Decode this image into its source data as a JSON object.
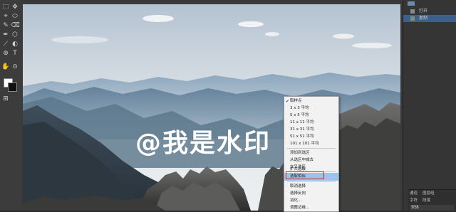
{
  "tools": [
    "⬚",
    "✥",
    "⌖",
    "⬭",
    "✎",
    "⌫",
    "✒",
    "⬡",
    "⟋",
    "◐",
    "⊕",
    "T",
    "✋",
    "⊙",
    "⊞"
  ],
  "history_panel": {
    "file_label": "",
    "items": [
      {
        "label": "打开"
      },
      {
        "label": "复制"
      }
    ]
  },
  "watermark_text": "@我是水印",
  "context_menu": {
    "items": [
      {
        "label": "取样点",
        "checked": true
      },
      {
        "label": "3 x 3 平均"
      },
      {
        "label": "5 x 5 平均"
      },
      {
        "label": "11 x 11 平均"
      },
      {
        "label": "31 x 31 平均"
      },
      {
        "label": "51 x 51 平均"
      },
      {
        "label": "101 x 101 平均"
      },
      {
        "label": "添加到选区"
      },
      {
        "label": "从选区中减去"
      },
      {
        "label": "交叉选区"
      },
      {
        "label": "扩大选取"
      },
      {
        "label": "选取相似",
        "highlighted": true
      },
      {
        "label": "取消选择"
      },
      {
        "label": "选择反向"
      },
      {
        "label": "羽化..."
      },
      {
        "label": "调整边缘..."
      }
    ]
  },
  "bottom_panel": {
    "row1_a": "通道",
    "row1_b": "图层组",
    "row2_a": "字符",
    "row2_b": "段落",
    "row3": "宋体"
  }
}
